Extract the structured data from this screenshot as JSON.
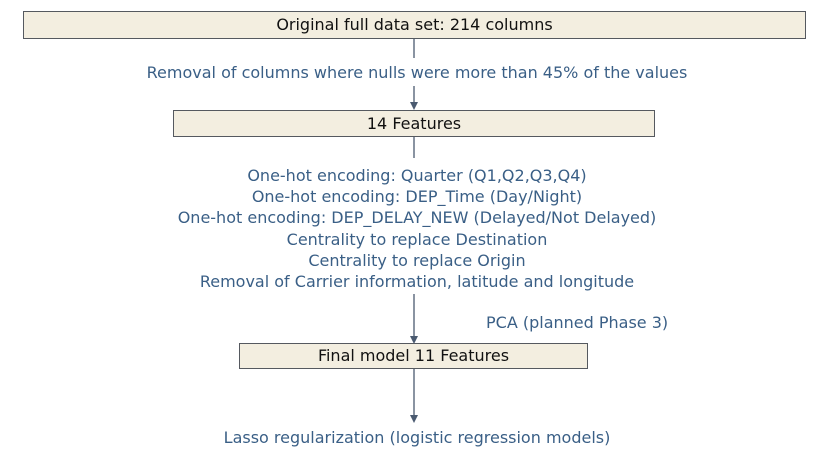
{
  "boxes": {
    "original": "Original full data set: 214 columns",
    "features14": "14 Features",
    "final": "Final model 11 Features"
  },
  "steps": {
    "null_removal": "Removal of columns where nulls were more than 45% of the values",
    "transform_lines": [
      "One-hot encoding: Quarter (Q1,Q2,Q3,Q4)",
      "One-hot encoding: DEP_Time (Day/Night)",
      "One-hot encoding: DEP_DELAY_NEW (Delayed/Not Delayed)",
      "Centrality to replace Destination",
      "Centrality to replace Origin",
      "Removal of  Carrier information, latitude and longitude"
    ],
    "pca_note": "PCA (planned Phase 3)",
    "final_step": "Lasso regularization (logistic regression models)"
  },
  "colors": {
    "box_fill": "#f3eee0",
    "box_border": "#55595f",
    "annotation_text": "#3a5f86",
    "connector": "#4a5a70"
  }
}
